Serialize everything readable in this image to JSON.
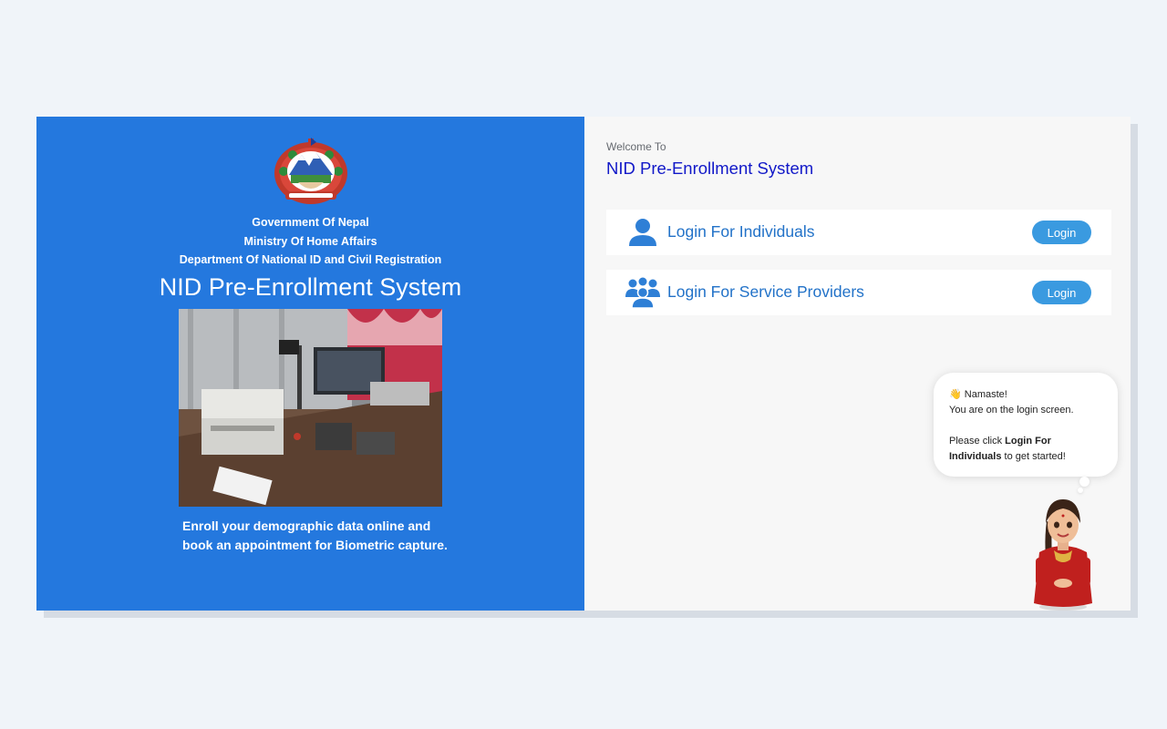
{
  "left": {
    "gov_lines": [
      "Government Of Nepal",
      "Ministry Of Home Affairs",
      "Department Of National ID and Civil Registration"
    ],
    "title": "NID Pre-Enrollment System",
    "description_lines": [
      "Enroll your demographic data online and",
      "book an appointment for Biometric capture."
    ],
    "icons": {
      "emblem": "nepal-emblem-icon",
      "photo": "enrollment-station-photo"
    }
  },
  "right": {
    "welcome_small": "Welcome To",
    "welcome_title": "NID Pre-Enrollment System",
    "logins": [
      {
        "label": "Login For Individuals",
        "button": "Login",
        "icon": "user-icon"
      },
      {
        "label": "Login For Service Providers",
        "button": "Login",
        "icon": "users-group-icon"
      }
    ]
  },
  "assistant": {
    "greeting": "Namaste!",
    "line1": "You are on the login screen.",
    "line2_pre": "Please click ",
    "line2_bold": "Login For Individuals",
    "line2_post": " to get started!",
    "icon": "waving-hand-icon",
    "avatar": "assistant-avatar"
  },
  "colors": {
    "left_panel": "#2478de",
    "right_panel": "#f7f7f7",
    "title_blue": "#1118c8",
    "label_blue": "#2272c8",
    "button": "#3a9ae0"
  }
}
